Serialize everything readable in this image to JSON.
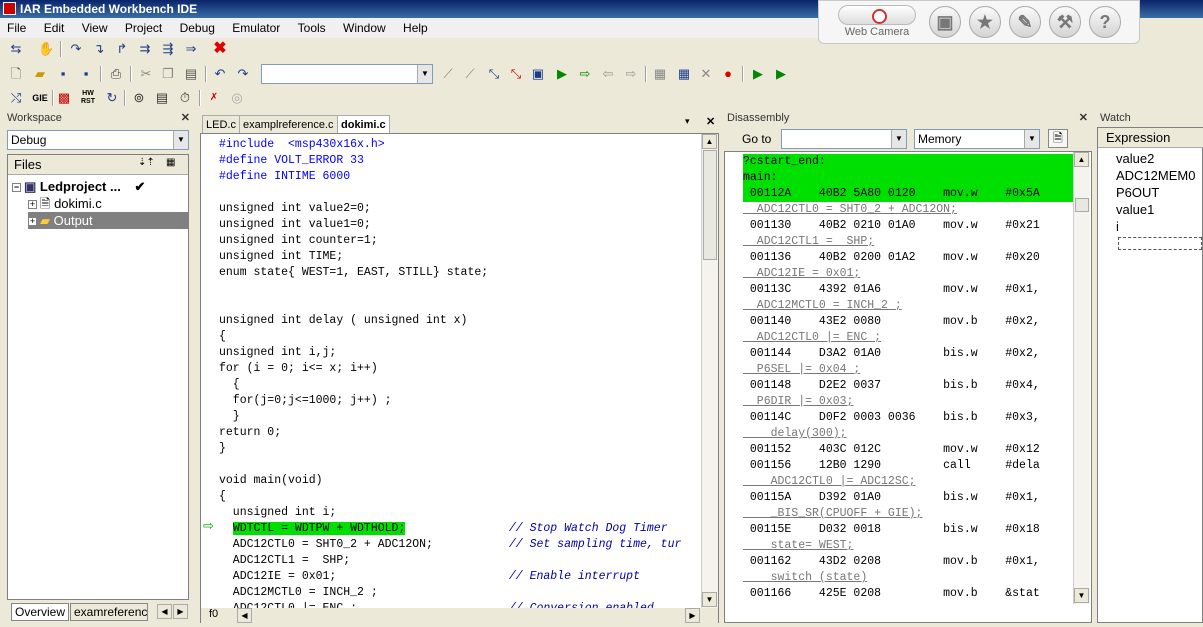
{
  "window": {
    "title": "IAR Embedded Workbench IDE"
  },
  "menu": [
    "File",
    "Edit",
    "View",
    "Project",
    "Debug",
    "Emulator",
    "Tools",
    "Window",
    "Help"
  ],
  "helper": {
    "webcam_label": "Web Camera",
    "buttons": [
      "id-card-icon",
      "star-icon",
      "edit-icon",
      "wrench-icon",
      "help-icon"
    ],
    "help_glyph": "?"
  },
  "workspace": {
    "title": "Workspace",
    "config": "Debug",
    "files_header": "Files",
    "tree": [
      {
        "label": "Ledproject ...",
        "check": "✔"
      },
      {
        "label": "dokimi.c"
      },
      {
        "label": "Output"
      }
    ],
    "tabs": [
      "Overview",
      "examreference"
    ]
  },
  "editor": {
    "tabs": [
      "LED.c",
      "examplreference.c",
      "dokimi.c"
    ],
    "footer": "f0",
    "lines": [
      {
        "t": "#include  <msp430x16x.h>"
      },
      {
        "t": "#define VOLT_ERROR 33"
      },
      {
        "t": "#define INTIME 6000"
      },
      {
        "t": ""
      },
      {
        "t": "unsigned int value2=0;"
      },
      {
        "t": "unsigned int value1=0;"
      },
      {
        "t": "unsigned int counter=1;"
      },
      {
        "t": "unsigned int TIME;"
      },
      {
        "t": "enum state{ WEST=1, EAST, STILL} state;"
      },
      {
        "t": ""
      },
      {
        "t": ""
      },
      {
        "t": "unsigned int delay ( unsigned int x)"
      },
      {
        "t": "{"
      },
      {
        "t": "unsigned int i,j;"
      },
      {
        "t": "for (i = 0; i<= x; i++)"
      },
      {
        "t": "  {"
      },
      {
        "t": "  for(j=0;j<=1000; j++) ;"
      },
      {
        "t": "  }"
      },
      {
        "t": "return 0;"
      },
      {
        "t": "}"
      },
      {
        "t": ""
      },
      {
        "t": "void main(void)"
      },
      {
        "t": "{"
      },
      {
        "t": "  unsigned int i;"
      },
      {
        "t": "  WDTCTL = WDTPW + WDTHOLD;",
        "c": "// Stop Watch Dog Timer",
        "hl": true
      },
      {
        "t": "  ADC12CTL0 = SHT0_2 + ADC12ON;",
        "c": "// Set sampling time, tur"
      },
      {
        "t": "  ADC12CTL1 =  SHP;"
      },
      {
        "t": "  ADC12IE = 0x01;",
        "c": "// Enable interrupt"
      },
      {
        "t": "  ADC12MCTL0 = INCH_2 ;"
      },
      {
        "t": "  ADC12CTL0 |= ENC ;",
        "c": "// Conversion enabled"
      }
    ]
  },
  "disassembly": {
    "title": "Disassembly",
    "goto_label": "Go to",
    "memory_label": "Memory",
    "lines": [
      {
        "kind": "hl",
        "text": "?cstart_end:"
      },
      {
        "kind": "hl",
        "text": "main:"
      },
      {
        "kind": "hl",
        "text": " 00112A    40B2 5A80 0120    mov.w    #0x5A"
      },
      {
        "kind": "src",
        "text": "  ADC12CTL0 = SHT0_2 + ADC12ON;"
      },
      {
        "kind": "asm",
        "text": " 001130    40B2 0210 01A0    mov.w    #0x21"
      },
      {
        "kind": "src",
        "text": "  ADC12CTL1 =  SHP;"
      },
      {
        "kind": "asm",
        "text": " 001136    40B2 0200 01A2    mov.w    #0x20"
      },
      {
        "kind": "src",
        "text": "  ADC12IE = 0x01;"
      },
      {
        "kind": "asm",
        "text": " 00113C    4392 01A6         mov.w    #0x1,"
      },
      {
        "kind": "src",
        "text": "  ADC12MCTL0 = INCH_2 ;"
      },
      {
        "kind": "asm",
        "text": " 001140    43E2 0080         mov.b    #0x2,"
      },
      {
        "kind": "src",
        "text": "  ADC12CTL0 |= ENC ;"
      },
      {
        "kind": "asm",
        "text": " 001144    D3A2 01A0         bis.w    #0x2,"
      },
      {
        "kind": "src",
        "text": "  P6SEL |= 0x04 ;"
      },
      {
        "kind": "asm",
        "text": " 001148    D2E2 0037         bis.b    #0x4,"
      },
      {
        "kind": "src",
        "text": "  P6DIR |= 0x03;"
      },
      {
        "kind": "asm",
        "text": " 00114C    D0F2 0003 0036    bis.b    #0x3,"
      },
      {
        "kind": "src",
        "text": "    delay(300);"
      },
      {
        "kind": "asm",
        "text": " 001152    403C 012C         mov.w    #0x12"
      },
      {
        "kind": "asm",
        "text": " 001156    12B0 1290         call     #dela"
      },
      {
        "kind": "src",
        "text": "    ADC12CTL0 |= ADC12SC;"
      },
      {
        "kind": "asm",
        "text": " 00115A    D392 01A0         bis.w    #0x1,"
      },
      {
        "kind": "src",
        "text": "    _BIS_SR(CPUOFF + GIE);"
      },
      {
        "kind": "asm",
        "text": " 00115E    D032 0018         bis.w    #0x18"
      },
      {
        "kind": "src",
        "text": "    state= WEST;"
      },
      {
        "kind": "asm",
        "text": " 001162    43D2 0208         mov.b    #0x1,"
      },
      {
        "kind": "src",
        "text": "    switch (state)"
      },
      {
        "kind": "asm",
        "text": " 001166    425E 0208         mov.b    &stat"
      }
    ]
  },
  "watch": {
    "title": "Watch",
    "header": "Expression",
    "items": [
      "value2",
      "ADC12MEM0",
      "P6OUT",
      "value1",
      "i"
    ]
  },
  "colors": {
    "highlight": "#00e000",
    "titlebar": "#0a246a"
  }
}
